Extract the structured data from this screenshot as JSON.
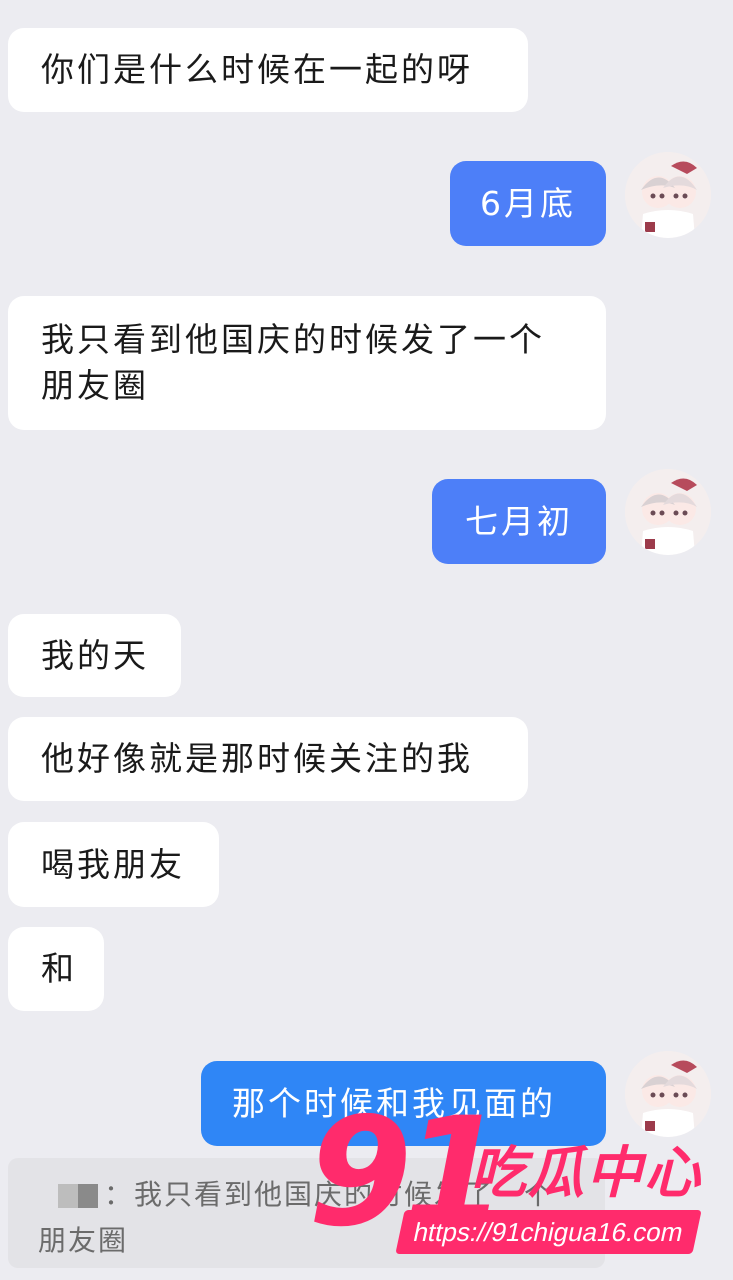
{
  "messages": [
    {
      "side": "in",
      "text": "你们是什么时候在一起的呀"
    },
    {
      "side": "out",
      "text": "6月底"
    },
    {
      "side": "in",
      "text_line1": "我只看到他国庆的时候发了一个",
      "text_line2": "朋友圈"
    },
    {
      "side": "out",
      "text": "七月初"
    },
    {
      "side": "in",
      "text": "我的天"
    },
    {
      "side": "in",
      "text": "他好像就是那时候关注的我"
    },
    {
      "side": "in",
      "text": "喝我朋友"
    },
    {
      "side": "in",
      "text": "和"
    },
    {
      "side": "out",
      "text": "那个时候和我见面的"
    }
  ],
  "quote": {
    "sender_separator": "：",
    "text_line1": "我只看到他国庆的时候发了一个",
    "text_line2": "朋友圈"
  },
  "watermark": {
    "number": "91",
    "title": "吃瓜中心",
    "url": "https://91chigua16.com"
  },
  "colors": {
    "background": "#ececf1",
    "incoming_bubble": "#ffffff",
    "outgoing_bubble": "#4d7ff8",
    "watermark": "#ff2b6c"
  }
}
